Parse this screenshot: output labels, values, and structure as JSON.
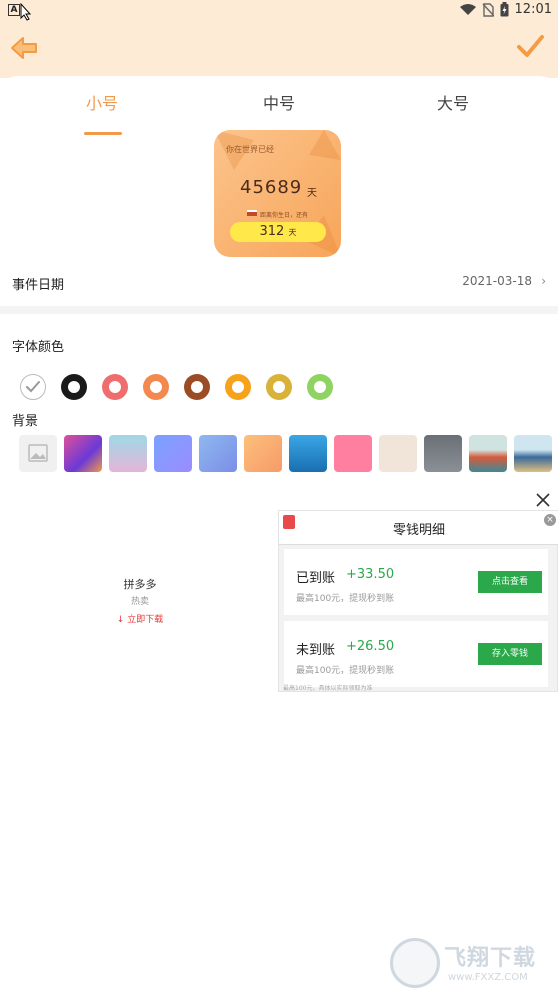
{
  "status_bar": {
    "time": "12:01"
  },
  "size_tabs": [
    {
      "label": "小号",
      "active": true
    },
    {
      "label": "中号",
      "active": false
    },
    {
      "label": "大号",
      "active": false
    }
  ],
  "widget": {
    "title": "你在世界已经",
    "days": "45689",
    "unit": "天",
    "subtitle": "距离你生日，还有",
    "countdown": "312",
    "countdown_unit": "天"
  },
  "event_date": {
    "label": "事件日期",
    "value": "2021-03-18"
  },
  "font_color": {
    "title": "字体颜色",
    "colors": [
      "#ffffff",
      "#1a1a1a",
      "#f06d6d",
      "#f4894f",
      "#9b4c24",
      "#f7a21b",
      "#d9b23a",
      "#8fd463"
    ]
  },
  "background": {
    "title": "背景"
  },
  "ad_left": {
    "name": "拼多多",
    "tag": "热卖",
    "download": "立即下载"
  },
  "ad": {
    "title": "零钱明细",
    "rows": [
      {
        "label": "已到账",
        "amount": "+33.50",
        "sub": "最高100元，提现秒到账",
        "button": "点击查看"
      },
      {
        "label": "未到账",
        "amount": "+26.50",
        "sub": "最高100元，提现秒到账",
        "button": "存入零钱"
      }
    ],
    "footnote": "最高100元，具体以实际领取为准"
  },
  "watermark": {
    "title": "飞翔下载",
    "url": "www.FXXZ.COM"
  }
}
